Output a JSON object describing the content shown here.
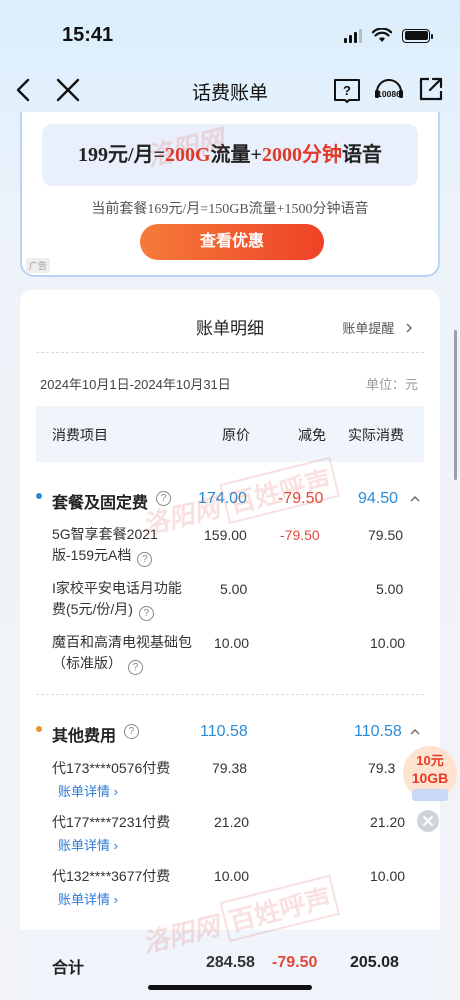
{
  "status": {
    "time": "15:41"
  },
  "nav": {
    "title": "话费账单",
    "service_label": "10086"
  },
  "ad": {
    "plan_prefix": "199元/月=",
    "plan_data": "200G",
    "plan_mid": "流量+",
    "plan_voice": "2000分钟",
    "plan_suffix": "语音",
    "current_plan": "当前套餐169元/月=150GB流量+1500分钟语音",
    "button": "查看优惠",
    "tag": "广告"
  },
  "bill": {
    "title": "账单明细",
    "reminder": "账单提醒",
    "date_range": "2024年10月1日-2024年10月31日",
    "unit": "单位：元",
    "columns": [
      "消费项目",
      "原价",
      "减免",
      "实际消费"
    ],
    "sections": [
      {
        "title": "套餐及固定费",
        "original": "174.00",
        "discount": "-79.50",
        "actual": "94.50",
        "items": [
          {
            "line1": "5G智享套餐2021",
            "line2": "版-159元A档",
            "original": "159.00",
            "discount": "-79.50",
            "actual": "79.50"
          },
          {
            "line1": "I家校平安电话月功能",
            "line2": "费(5元/份/月)",
            "original": "5.00",
            "discount": "",
            "actual": "5.00"
          },
          {
            "line1": "魔百和高清电视基础包",
            "line2": "（标准版）",
            "original": "10.00",
            "discount": "",
            "actual": "10.00"
          }
        ]
      },
      {
        "title": "其他费用",
        "original": "110.58",
        "discount": "",
        "actual": "110.58",
        "items": [
          {
            "line1": "代173****0576付费",
            "link": "账单详情",
            "original": "79.38",
            "actual": "79.3"
          },
          {
            "line1": "代177****7231付费",
            "link": "账单详情",
            "original": "21.20",
            "actual": "21.20"
          },
          {
            "line1": "代132****3677付费",
            "link": "账单详情",
            "original": "10.00",
            "actual": "10.00"
          }
        ]
      }
    ],
    "total": {
      "label": "合计",
      "original": "284.58",
      "discount": "-79.50",
      "actual": "205.08"
    }
  },
  "float_badge": {
    "line1": "10元",
    "line2": "10GB"
  },
  "watermark": {
    "text": "洛阳网",
    "box": "百姓呼声"
  },
  "colors": {
    "accent_blue": "#2b8bd6",
    "discount_red": "#e04a3a",
    "plan_red": "#e03a2a",
    "button_orange": "#ee4226"
  }
}
